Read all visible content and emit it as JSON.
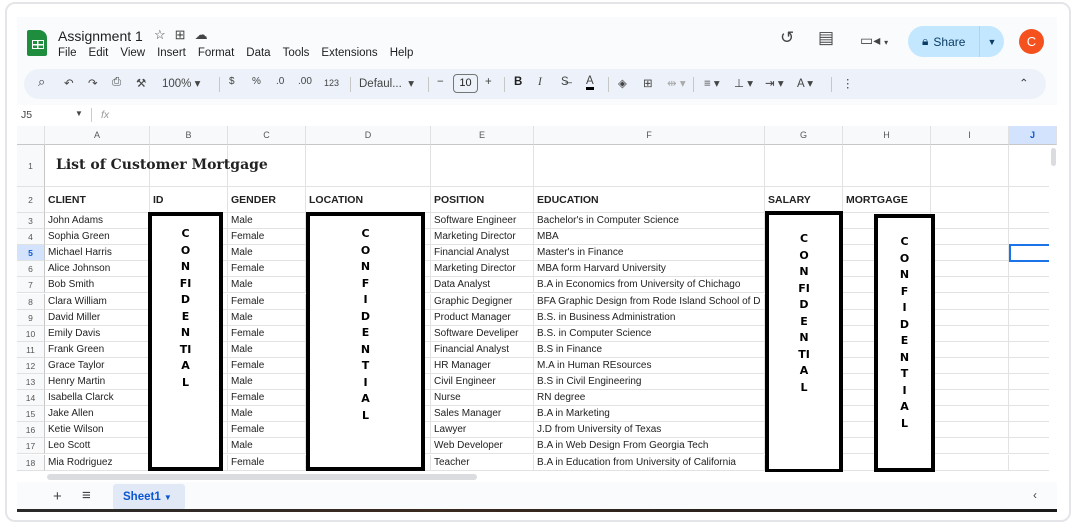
{
  "app": {
    "title": "Assignment 1",
    "menu": [
      "File",
      "Edit",
      "View",
      "Insert",
      "Format",
      "Data",
      "Tools",
      "Extensions",
      "Help"
    ],
    "share_label": "Share",
    "avatar_letter": "C",
    "accent": "#0b57d0",
    "share_bg": "#c2e7ff",
    "avatar_color": "#f4511e"
  },
  "toolbar": {
    "zoom": "100%",
    "currency": "$",
    "percent": "%",
    "dec_decrease": ".0",
    "dec_increase": ".00",
    "number_format": "123",
    "font": "Defaul...",
    "font_size": "10",
    "bold": "B",
    "italic": "I",
    "text_color": "A"
  },
  "formula_bar": {
    "cell_ref": "J5",
    "fx": "fx",
    "value": ""
  },
  "columns": [
    "A",
    "B",
    "C",
    "D",
    "E",
    "F",
    "G",
    "H",
    "I",
    "J"
  ],
  "selected": {
    "column": "J",
    "row": 5
  },
  "sheet": {
    "title": "List of Customer Mortgage",
    "headers": [
      "CLIENT",
      "ID",
      "GENDER",
      "LOCATION",
      "POSITION",
      "EDUCATION",
      "SALARY",
      "MORTGAGE"
    ],
    "rows": [
      [
        "John Adams",
        "Male",
        "Software Engineer",
        "Bachelor's in Computer Science"
      ],
      [
        "Sophia Green",
        "Female",
        "Marketing Director",
        "MBA"
      ],
      [
        "Michael Harris",
        "Male",
        "Financial Analyst",
        "Master's in Finance"
      ],
      [
        "Alice Johnson",
        "Female",
        "Marketing Director",
        "MBA form Harvard University"
      ],
      [
        "Bob Smith",
        "Male",
        "Data Analyst",
        "B.A in Economics from University of Chichago"
      ],
      [
        "Clara William",
        "Female",
        "Graphic Degigner",
        "BFA Graphic Design from Rode Island School of D"
      ],
      [
        "David Miller",
        "Male",
        "Product Manager",
        "B.S. in Business Administration"
      ],
      [
        "Emily Davis",
        "Female",
        "Software Develiper",
        "B.S. in Computer Science"
      ],
      [
        "Frank Green",
        "Male",
        "Financial Analyst",
        "B.S in Finance"
      ],
      [
        "Grace Taylor",
        "Female",
        "HR Manager",
        "M.A in Human REsources"
      ],
      [
        "Henry Martin",
        "Male",
        "Civil Engineer",
        "B.S in Civil Engineering"
      ],
      [
        "Isabella Clarck",
        "Female",
        "Nurse",
        "RN degree"
      ],
      [
        "Jake Allen",
        "Male",
        "Sales Manager",
        "B.A in Marketing"
      ],
      [
        "Ketie Wilson",
        "Female",
        "Lawyer",
        "J.D  from University of Texas"
      ],
      [
        "Leo Scott",
        "Male",
        "Web Developer",
        "B.A in Web Design From Georgia Tech"
      ],
      [
        "Mia Rodriguez",
        "Female",
        "Teacher",
        "B.A in Education from University of California"
      ]
    ],
    "confidential_id": [
      "C",
      "O",
      "N",
      "FI",
      "D",
      "E",
      "N",
      "TI",
      "A",
      "L"
    ],
    "confidential_location": [
      "C",
      "O",
      "N",
      "F",
      "I",
      "D",
      "E",
      "N",
      "T",
      "I",
      "A",
      "L"
    ],
    "confidential_salary": [
      "C",
      "O",
      "N",
      "FI",
      "D",
      "E",
      "N",
      "TI",
      "A",
      "L"
    ],
    "confidential_mortgage": [
      "C",
      "O",
      "N",
      "F",
      "I",
      "D",
      "E",
      "N",
      "T",
      "I",
      "A",
      "L"
    ]
  },
  "bottom": {
    "add": "+",
    "list": "≡",
    "sheet_tab": "Sheet1"
  }
}
